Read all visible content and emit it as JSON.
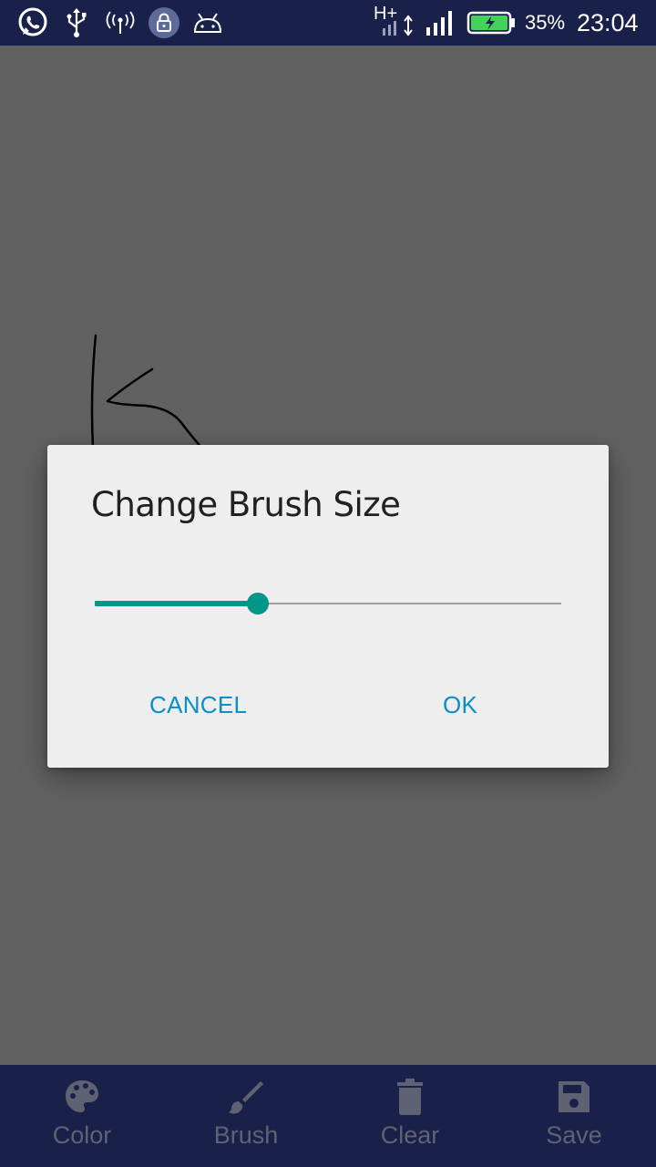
{
  "status_bar": {
    "icons": [
      "whatsapp-icon",
      "usb-icon",
      "hotspot-icon",
      "vpn-lock-icon",
      "android-debug-icon",
      "h-plus-data-icon",
      "signal-icon",
      "battery-charging-icon"
    ],
    "network_type": "H+",
    "battery_percent": "35%",
    "time": "23:04",
    "background_color": "#19204a"
  },
  "canvas": {
    "background_color": "#616161",
    "stroke_color": "#000000"
  },
  "dialog": {
    "title": "Change Brush Size",
    "brush_size_fraction": 0.35,
    "accent_color": "#009688",
    "cancel_label": "CANCEL",
    "ok_label": "OK",
    "button_color": "#0a8fc7"
  },
  "bottom_nav": {
    "items": [
      {
        "label": "Color",
        "icon": "palette-icon"
      },
      {
        "label": "Brush",
        "icon": "brush-icon"
      },
      {
        "label": "Clear",
        "icon": "trash-icon"
      },
      {
        "label": "Save",
        "icon": "save-icon"
      }
    ],
    "background_color": "#19204a"
  }
}
